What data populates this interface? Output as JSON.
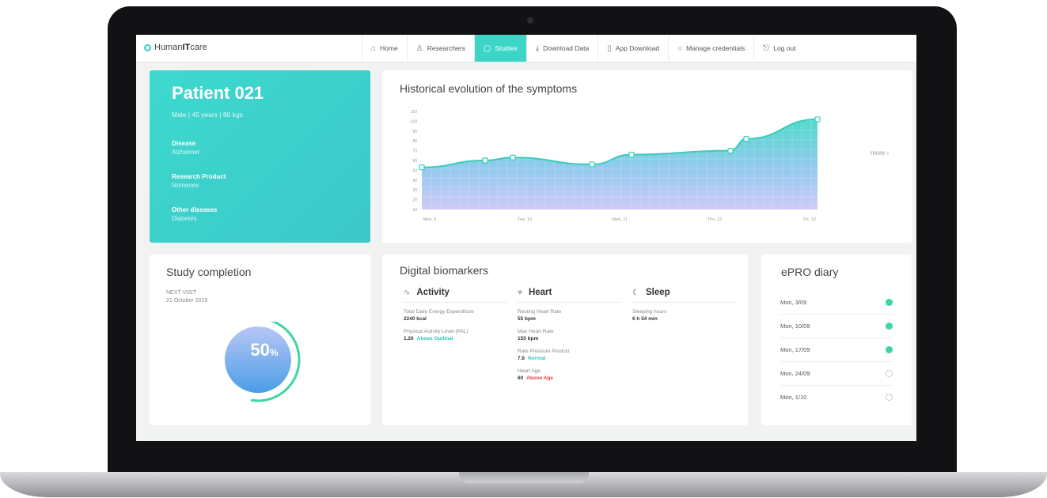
{
  "brand": {
    "name_pre": "Human",
    "name_bold": "IT",
    "name_post": "care"
  },
  "nav": [
    {
      "label": "Home",
      "icon": "home-icon"
    },
    {
      "label": "Researchers",
      "icon": "users-icon"
    },
    {
      "label": "Studies",
      "icon": "folder-icon",
      "active": true
    },
    {
      "label": "Download Data",
      "icon": "download-icon"
    },
    {
      "label": "App Download",
      "icon": "phone-icon"
    },
    {
      "label": "Manage credentials",
      "icon": "settings-icon"
    },
    {
      "label": "Log out",
      "icon": "logout-icon"
    }
  ],
  "patient": {
    "title": "Patient 021",
    "subtitle": "Male  |  45 years  |  80 kgs",
    "fields": [
      {
        "key": "Disease",
        "value": "Alzheimer"
      },
      {
        "key": "Research Product",
        "value": "Nomenex"
      },
      {
        "key": "Other diseases",
        "value": "Diabetes"
      }
    ]
  },
  "chart_data": {
    "type": "area",
    "title": "Historical evolution of the symptoms",
    "xlabel": "",
    "ylabel": "",
    "x_ticks": [
      "Mon, 6",
      "Tue, 10",
      "Wed, 11",
      "Thu, 12",
      "Fri, 13"
    ],
    "y_ticks": [
      10,
      20,
      30,
      40,
      50,
      60,
      70,
      80,
      90,
      100,
      110
    ],
    "ylim": [
      10,
      110
    ],
    "x": [
      0,
      0.16,
      0.23,
      0.43,
      0.53,
      0.78,
      0.82,
      1.0
    ],
    "values": [
      53,
      60,
      63,
      56,
      66,
      70,
      82,
      102
    ],
    "more_label": "more"
  },
  "colors": {
    "accent": "#3dd6c6",
    "alert": "#e94040",
    "done": "#3dd6a0"
  },
  "study": {
    "title": "Study completion",
    "next_visit_label": "NEXT VISIT",
    "next_visit_date": "21 October 2019",
    "progress_pct": 50,
    "progress_label": "50",
    "progress_unit": "%"
  },
  "biomarkers": {
    "title": "Digital biomarkers",
    "columns": [
      {
        "name": "Activity",
        "icon": "activity-icon",
        "metrics": [
          {
            "label": "Total Daily Energy Expenditure",
            "value": "2240 kcal",
            "status": ""
          },
          {
            "label": "Physical Activity Level (PAL)",
            "value": "1.20",
            "status": "Above Optimal"
          }
        ]
      },
      {
        "name": "Heart",
        "icon": "heart-icon",
        "metrics": [
          {
            "label": "Resting Heart Rate",
            "value": "55 bpm",
            "status": ""
          },
          {
            "label": "Max Heart Rate",
            "value": "155 bpm",
            "status": ""
          },
          {
            "label": "Rate Pressure Product",
            "value": "7.8",
            "status": "Normal"
          },
          {
            "label": "Heart Age",
            "value": "60",
            "status": "Above Age"
          }
        ]
      },
      {
        "name": "Sleep",
        "icon": "moon-icon",
        "metrics": [
          {
            "label": "Sleeping hours",
            "value": "6 h 54 min",
            "status": ""
          }
        ]
      }
    ]
  },
  "epro": {
    "title": "ePRO diary",
    "entries": [
      {
        "date": "Mon, 3/09",
        "done": true
      },
      {
        "date": "Mon, 10/09",
        "done": true
      },
      {
        "date": "Mon, 17/09",
        "done": true
      },
      {
        "date": "Mon, 24/09",
        "done": false
      },
      {
        "date": "Mon, 1/10",
        "done": false
      }
    ]
  }
}
